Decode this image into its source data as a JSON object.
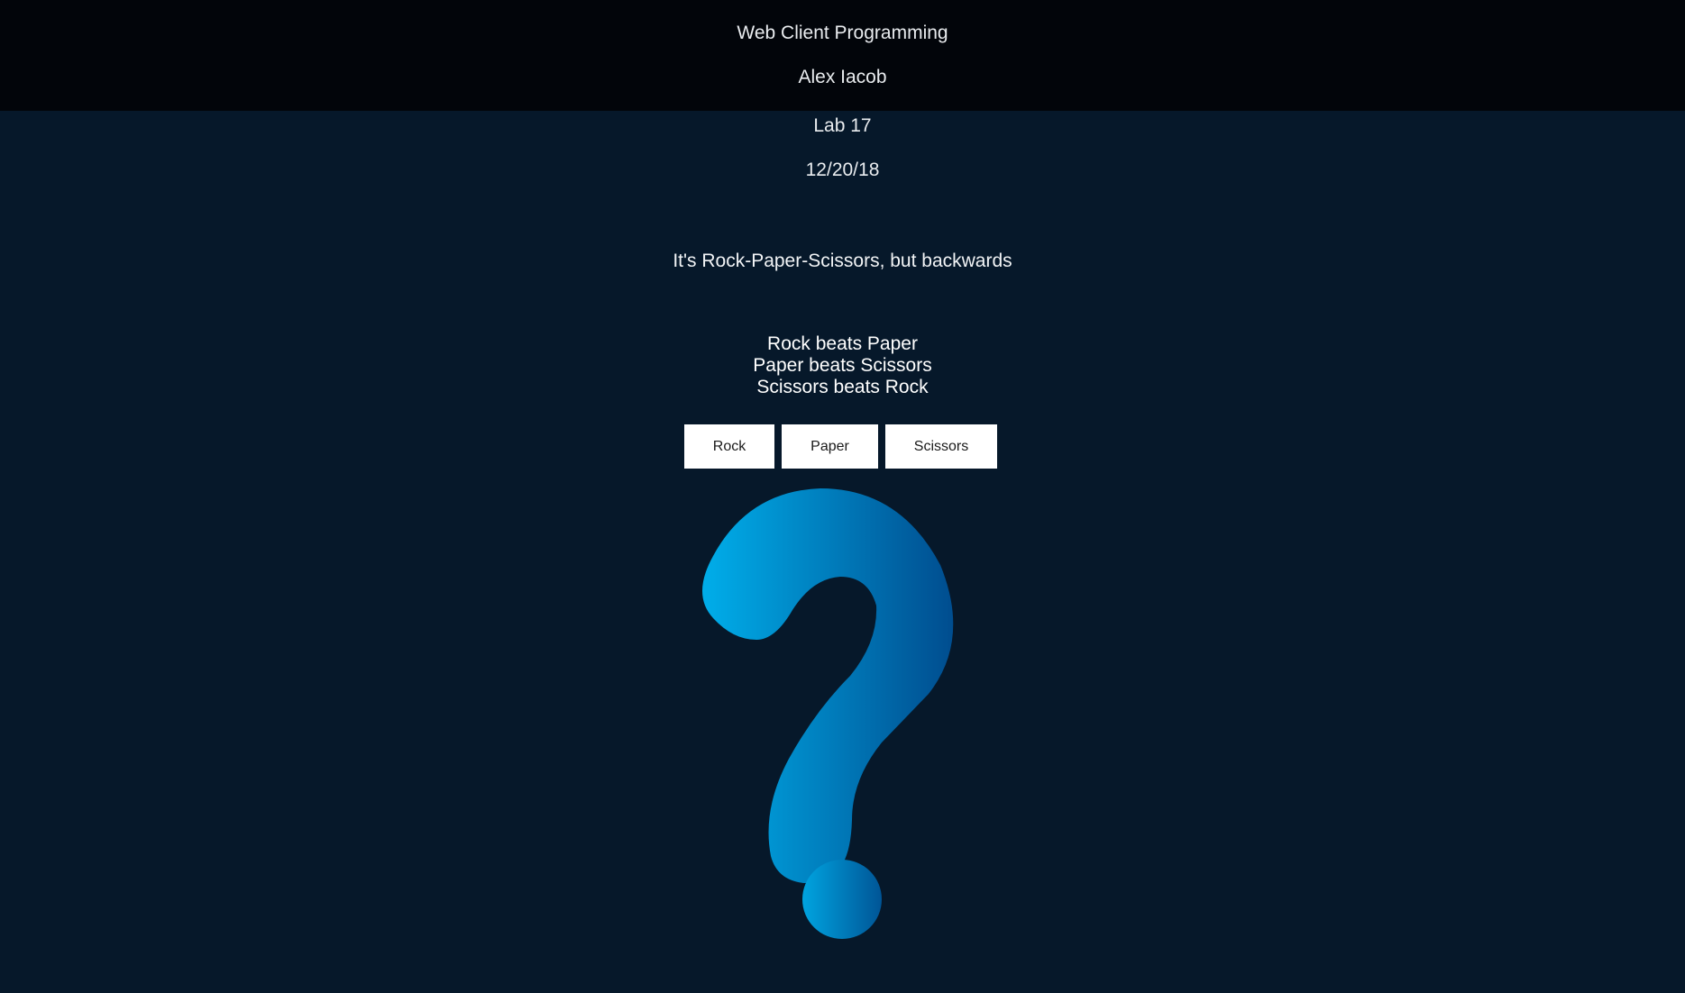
{
  "header": {
    "course": "Web Client Programming",
    "author": "Alex Iacob",
    "lab": "Lab 17",
    "date": "12/20/18"
  },
  "main": {
    "tagline": "It's Rock-Paper-Scissors, but backwards",
    "rules": [
      "Rock beats Paper",
      "Paper beats Scissors",
      "Scissors beats Rock"
    ],
    "buttons": {
      "rock": "Rock",
      "paper": "Paper",
      "scissors": "Scissors"
    },
    "result_icon": "question-mark-icon"
  },
  "colors": {
    "background": "#06182a",
    "header_background": "#02050a",
    "button_background": "#ffffff",
    "icon_gradient_light": "#00aeea",
    "icon_gradient_dark": "#004d8f"
  }
}
